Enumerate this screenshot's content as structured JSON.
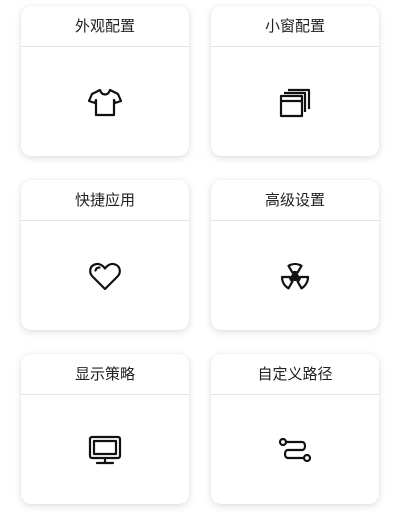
{
  "cards": [
    {
      "label": "外观配置",
      "icon": "tshirt-icon"
    },
    {
      "label": "小窗配置",
      "icon": "windows-stack-icon"
    },
    {
      "label": "快捷应用",
      "icon": "heart-icon"
    },
    {
      "label": "高级设置",
      "icon": "radiation-icon"
    },
    {
      "label": "显示策略",
      "icon": "monitor-icon"
    },
    {
      "label": "自定义路径",
      "icon": "route-icon"
    }
  ],
  "colors": {
    "icon_stroke": "#111111",
    "card_background": "#ffffff",
    "divider": "#e4e4e4"
  }
}
